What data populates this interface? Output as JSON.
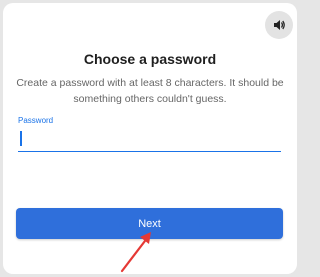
{
  "page": {
    "title": "Choose a password",
    "description": "Create a password with at least 8 characters. It should be something others couldn't guess."
  },
  "password_field": {
    "label": "Password",
    "value": ""
  },
  "buttons": {
    "next_label": "Next",
    "sound_icon": "speaker-icon"
  },
  "annotation": {
    "arrow_color": "#e53935"
  },
  "colors": {
    "accent": "#1a73e8",
    "button": "#2f6fdb"
  }
}
